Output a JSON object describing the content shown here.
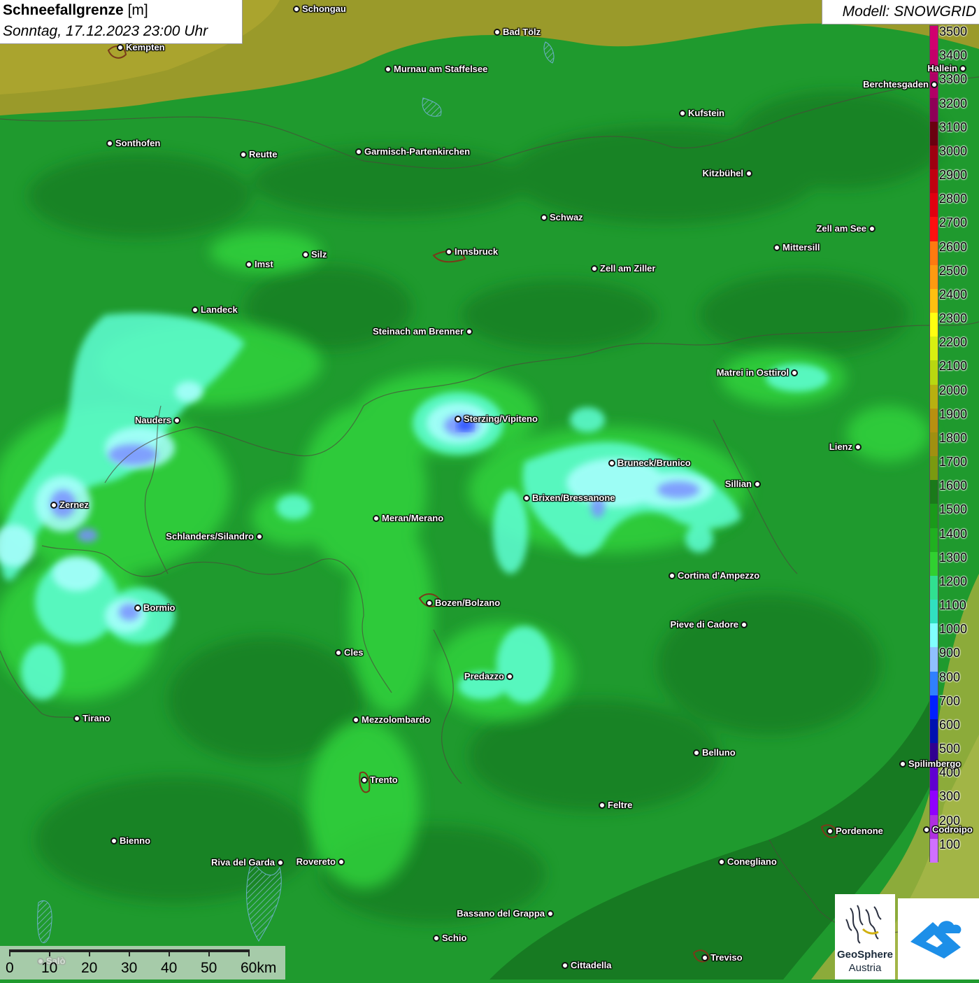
{
  "title": {
    "param": "Schneefallgrenze",
    "unit": " [m]",
    "datetime": "Sonntag, 17.12.2023 23:00 Uhr"
  },
  "model": "Modell: SNOWGRID",
  "legend": {
    "labels": [
      "3500",
      "3400",
      "3300",
      "3200",
      "3100",
      "3000",
      "2900",
      "2800",
      "2700",
      "2600",
      "2500",
      "2400",
      "2300",
      "2200",
      "2100",
      "2000",
      "1900",
      "1800",
      "1700",
      "1600",
      "1500",
      "1400",
      "1300",
      "1200",
      "1100",
      "1000",
      "900",
      "800",
      "700",
      "600",
      "500",
      "400",
      "300",
      "200",
      "100"
    ],
    "colors": [
      "#d1006f",
      "#c4006a",
      "#b00066",
      "#8e0057",
      "#6a0010",
      "#9e0010",
      "#c00010",
      "#e00010",
      "#ff1010",
      "#ff7a10",
      "#ff9a10",
      "#ffc010",
      "#ffff10",
      "#d8f010",
      "#b8d810",
      "#b8b010",
      "#b89010",
      "#a09010",
      "#7a9a10",
      "#1a7a1a",
      "#1a9a1a",
      "#20b020",
      "#30d030",
      "#30e090",
      "#30e0c0",
      "#80ffff",
      "#90c0ff",
      "#3080ff",
      "#0020ff",
      "#0010b0",
      "#300090",
      "#6000d0",
      "#9000ff",
      "#b030e0",
      "#d070ff"
    ]
  },
  "cities": [
    {
      "name": "Schongau",
      "label_side": "right"
    },
    {
      "name": "Bad Tölz",
      "label_side": "right"
    },
    {
      "name": "Kempten",
      "label_side": "right"
    },
    {
      "name": "Murnau am Staffelsee",
      "label_side": "right"
    },
    {
      "name": "Hallein",
      "label_side": "left"
    },
    {
      "name": "Berchtesgaden",
      "label_side": "left"
    },
    {
      "name": "Kufstein",
      "label_side": "right"
    },
    {
      "name": "Sonthofen",
      "label_side": "right"
    },
    {
      "name": "Reutte",
      "label_side": "right"
    },
    {
      "name": "Garmisch-Partenkirchen",
      "label_side": "right"
    },
    {
      "name": "Kitzbühel",
      "label_side": "left"
    },
    {
      "name": "Schwaz",
      "label_side": "right"
    },
    {
      "name": "Zell am See",
      "label_side": "left"
    },
    {
      "name": "Innsbruck",
      "label_side": "right"
    },
    {
      "name": "Mittersill",
      "label_side": "right"
    },
    {
      "name": "Imst",
      "label_side": "right"
    },
    {
      "name": "Silz",
      "label_side": "right"
    },
    {
      "name": "Zell am Ziller",
      "label_side": "right"
    },
    {
      "name": "Landeck",
      "label_side": "right"
    },
    {
      "name": "Steinach am Brenner",
      "label_side": "left"
    },
    {
      "name": "Matrei in Osttirol",
      "label_side": "left"
    },
    {
      "name": "Nauders",
      "label_side": "left"
    },
    {
      "name": "Sterzing/Vipiteno",
      "label_side": "right"
    },
    {
      "name": "Lienz",
      "label_side": "left"
    },
    {
      "name": "Bruneck/Brunico",
      "label_side": "right"
    },
    {
      "name": "Sillian",
      "label_side": "left"
    },
    {
      "name": "Brixen/Bressanone",
      "label_side": "right"
    },
    {
      "name": "Zernez",
      "label_side": "right"
    },
    {
      "name": "Meran/Merano",
      "label_side": "right"
    },
    {
      "name": "Schlanders/Silandro",
      "label_side": "left"
    },
    {
      "name": "Cortina d'Ampezzo",
      "label_side": "right"
    },
    {
      "name": "Bozen/Bolzano",
      "label_side": "right"
    },
    {
      "name": "Bormio",
      "label_side": "right"
    },
    {
      "name": "Pieve di Cadore",
      "label_side": "left"
    },
    {
      "name": "Cles",
      "label_side": "right"
    },
    {
      "name": "Predazzo",
      "label_side": "left"
    },
    {
      "name": "Tirano",
      "label_side": "right"
    },
    {
      "name": "Mezzolombardo",
      "label_side": "right"
    },
    {
      "name": "Belluno",
      "label_side": "right"
    },
    {
      "name": "Spilimbergo",
      "label_side": "right"
    },
    {
      "name": "Trento",
      "label_side": "right"
    },
    {
      "name": "Feltre",
      "label_side": "right"
    },
    {
      "name": "Pordenone",
      "label_side": "right"
    },
    {
      "name": "Codroipo",
      "label_side": "right"
    },
    {
      "name": "Bienno",
      "label_side": "right"
    },
    {
      "name": "Riva del Garda",
      "label_side": "left"
    },
    {
      "name": "Rovereto",
      "label_side": "left"
    },
    {
      "name": "Conegliano",
      "label_side": "right"
    },
    {
      "name": "Bassano del Grappa",
      "label_side": "left"
    },
    {
      "name": "Schio",
      "label_side": "right"
    },
    {
      "name": "Salò",
      "label_side": "right"
    },
    {
      "name": "Treviso",
      "label_side": "right"
    },
    {
      "name": "Cittadella",
      "label_side": "right"
    }
  ],
  "scale": {
    "labels": [
      "0",
      "10",
      "20",
      "30",
      "40",
      "50",
      "60km"
    ]
  },
  "logo": {
    "line1": "GeoSphere",
    "line2": "Austria"
  },
  "colors": {
    "lowland_olive": "#9a9a2a",
    "alpine_green": "#1e9c2c",
    "valley_light": "#33d63d",
    "cyan_zone": "#7fffe0",
    "blue_zone": "#5a7aff"
  }
}
